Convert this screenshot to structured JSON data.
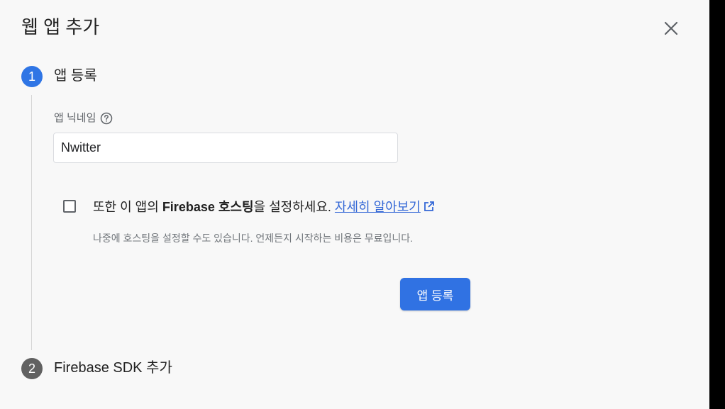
{
  "dialog": {
    "title": "웹 앱 추가",
    "close_icon": "close-icon"
  },
  "step1": {
    "number": "1",
    "title": "앱 등록",
    "nickname_label": "앱 닉네임",
    "help_icon": "help-circle-icon",
    "nickname_value": "Nwitter",
    "hosting_prefix": "또한 이 앱의 ",
    "hosting_bold": "Firebase 호스팅",
    "hosting_suffix": "을 설정하세요. ",
    "learn_more": "자세히 알아보기",
    "external_link_icon": "external-link-icon",
    "hosting_checked": false,
    "hosting_note": "나중에 호스팅을 설정할 수도 있습니다. 언제든지 시작하는 비용은 무료입니다.",
    "register_button": "앱 등록"
  },
  "step2": {
    "number": "2",
    "title": "Firebase SDK 추가"
  },
  "colors": {
    "accent": "#3072e3",
    "inactive_step": "#616161",
    "link": "#3367d6"
  }
}
